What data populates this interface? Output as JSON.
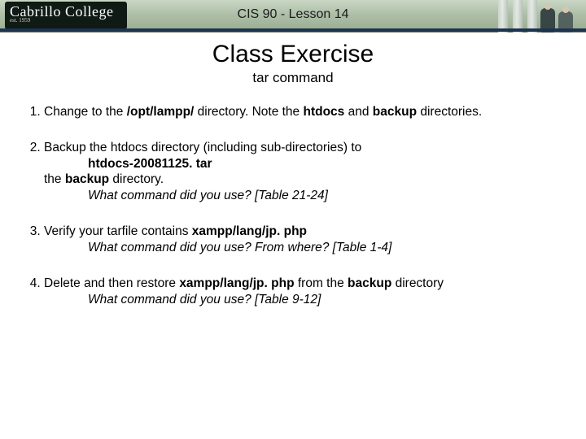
{
  "header": {
    "logo_main": "Cabrillo College",
    "logo_sub": "est. 1959",
    "course_title": "CIS 90 - Lesson 14"
  },
  "title": "Class Exercise",
  "subtitle": "tar command",
  "steps": {
    "s1": {
      "a": "Change to the ",
      "b": "/opt/lampp/",
      "c": " directory. Note the ",
      "d": "htdocs",
      "e": " and ",
      "f": "backup",
      "g": " directories."
    },
    "s2": {
      "a": "Backup the htdocs directory (including sub-directories) to",
      "file": "htdocs-20081125. tar",
      "b1": "the ",
      "b2": "backup",
      "b3": " directory.",
      "hint": "What command did you use? [Table 21-24]"
    },
    "s3": {
      "a": "Verify your tarfile contains ",
      "b": "xampp/lang/jp. php",
      "hint": "What command did you use? From where? [Table 1-4]"
    },
    "s4": {
      "a": "Delete and then restore ",
      "b": "xampp/lang/jp. php",
      "c": " from the ",
      "d": "backup",
      "e": " directory",
      "hint": "What command  did you use? [Table 9-12]"
    }
  }
}
